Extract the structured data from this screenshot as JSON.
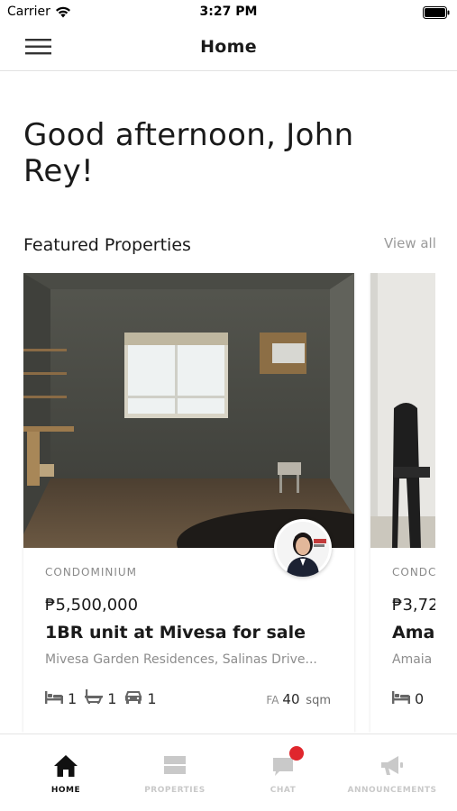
{
  "status_bar": {
    "carrier": "Carrier",
    "time": "3:27 PM"
  },
  "nav": {
    "title": "Home",
    "menu_icon": "hamburger-menu-icon"
  },
  "greeting": "Good afternoon, John Rey!",
  "featured": {
    "title": "Featured Properties",
    "view_all": "View all",
    "cards": [
      {
        "type": "CONDOMINIUM",
        "price": "₱5,500,000",
        "name": "1BR unit at Mivesa for sale",
        "address": "Mivesa Garden Residences, Salinas Drive...",
        "beds": "1",
        "baths": "1",
        "parking": "1",
        "fa_label": "FA",
        "floor_area": "40",
        "area_unit": "sqm"
      },
      {
        "type": "CONDC",
        "price": "₱3,72",
        "name": "Ama",
        "address": "Amaia",
        "beds": "0"
      }
    ]
  },
  "tabs": [
    {
      "label": "HOME",
      "icon": "home-icon",
      "active": true
    },
    {
      "label": "PROPERTIES",
      "icon": "properties-icon",
      "active": false
    },
    {
      "label": "CHAT",
      "icon": "chat-icon",
      "active": false,
      "badge": true
    },
    {
      "label": "ANNOUNCEMENTS",
      "icon": "megaphone-icon",
      "active": false
    }
  ],
  "colors": {
    "badge": "#e0262d",
    "active_tab": "#111111",
    "inactive_tab": "#c9c9c9"
  }
}
